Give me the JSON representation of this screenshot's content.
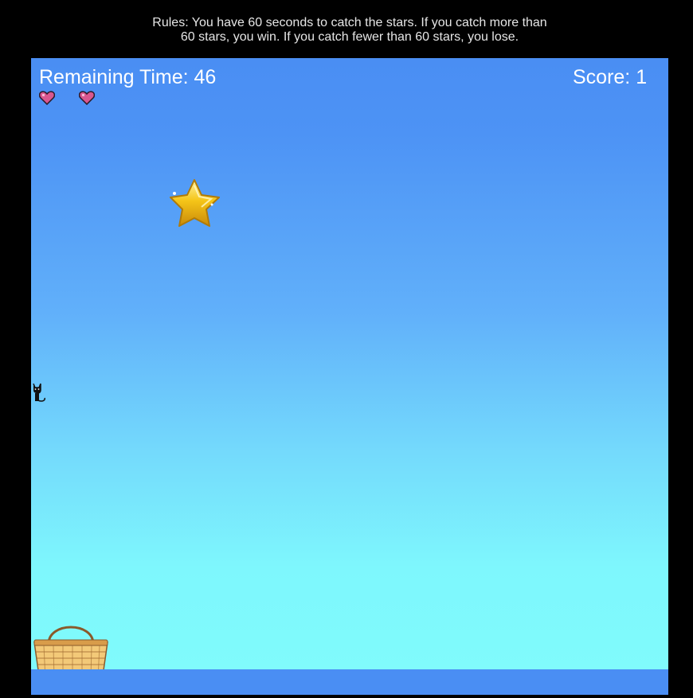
{
  "rules": {
    "line1": "Rules: You have 60 seconds to catch the stars. If you catch more than",
    "line2": "60 stars, you win. If you catch fewer than 60 stars, you lose."
  },
  "hud": {
    "time_label": "Remaining Time: 46",
    "score_label": "Score: 1",
    "lives": 2
  },
  "colors": {
    "page_background": "#000000",
    "sky_top": "#4a8ef3",
    "sky_bottom": "#80fcfc",
    "ground": "#4a8ef3",
    "heart": "#d9578f",
    "star": "#f5c518"
  },
  "icons": [
    "heart-icon",
    "star-icon",
    "cat-icon",
    "basket-icon"
  ]
}
